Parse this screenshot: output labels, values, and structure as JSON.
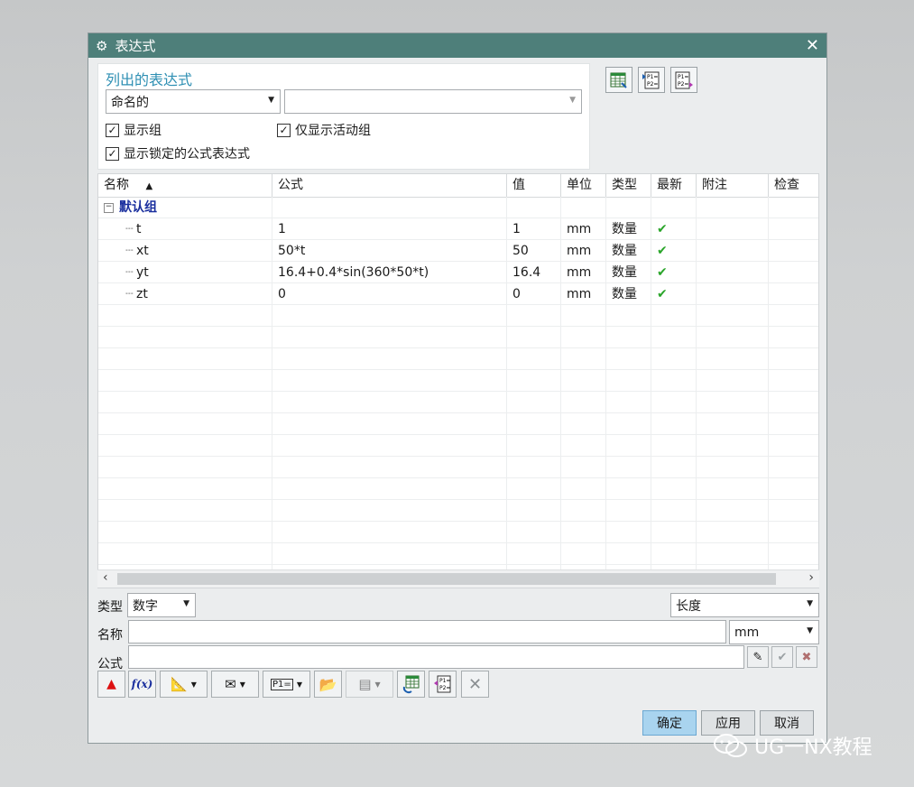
{
  "dialog": {
    "title": "表达式"
  },
  "list_panel": {
    "heading": "列出的表达式",
    "filter_select": "命名的",
    "filter_secondary": "",
    "checkboxes": {
      "show_groups": {
        "label": "显示组",
        "checked": true
      },
      "active_group_only": {
        "label": "仅显示活动组",
        "checked": true
      },
      "show_locked": {
        "label": "显示锁定的公式表达式",
        "checked": true
      }
    }
  },
  "table": {
    "columns": [
      "名称",
      "公式",
      "值",
      "单位",
      "类型",
      "最新",
      "附注",
      "检查"
    ],
    "group": "默认组",
    "rows": [
      {
        "name": "t",
        "formula": "1",
        "value": "1",
        "unit": "mm",
        "type": "数量"
      },
      {
        "name": "xt",
        "formula": "50*t",
        "value": "50",
        "unit": "mm",
        "type": "数量"
      },
      {
        "name": "yt",
        "formula": "16.4+0.4*sin(360*50*t)",
        "value": "16.4",
        "unit": "mm",
        "type": "数量"
      },
      {
        "name": "zt",
        "formula": "0",
        "value": "0",
        "unit": "mm",
        "type": "数量"
      }
    ]
  },
  "editor": {
    "type_label": "类型",
    "type_value": "数字",
    "dimension_value": "长度",
    "name_label": "名称",
    "name_value": "",
    "unit_value": "mm",
    "formula_label": "公式",
    "formula_value": ""
  },
  "buttons": {
    "ok": "确定",
    "apply": "应用",
    "cancel": "取消"
  },
  "watermark": {
    "text": "UG一NX教程"
  },
  "colors": {
    "title_bar": "#4e7f7a",
    "heading": "#2e8fb3",
    "group": "#1a2f9e",
    "check": "#2aa52a",
    "primary_button": "#a9d4ef"
  }
}
